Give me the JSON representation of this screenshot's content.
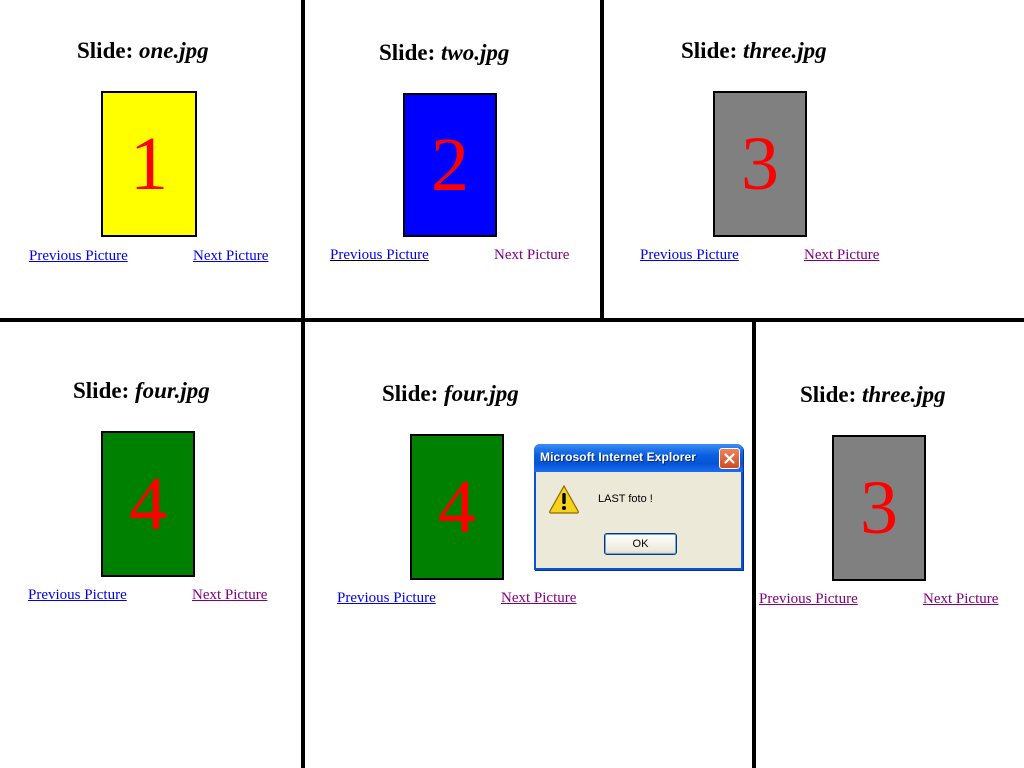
{
  "panels": [
    {
      "title_prefix": "Slide: ",
      "filename": "one.jpg",
      "slide_number": "1",
      "slide_color": "#ffff00",
      "prev_label": "Previous Picture",
      "next_label": "Next Picture"
    },
    {
      "title_prefix": "Slide: ",
      "filename": "two.jpg",
      "slide_number": "2",
      "slide_color": "#0000ff",
      "prev_label_first": "Previous",
      "prev_label_rest": " Picture",
      "next_label": "Next Picture"
    },
    {
      "title_prefix": "Slide: ",
      "filename": "three.jpg",
      "slide_number": "3",
      "slide_color": "#808080",
      "prev_label": "Previous Picture",
      "next_label": "Next Picture"
    },
    {
      "title_prefix": "Slide: ",
      "filename": "four.jpg",
      "slide_number": "4",
      "slide_color": "#008000",
      "prev_label": "Previous Picture",
      "next_label": "Next Picture"
    },
    {
      "title_prefix": "Slide: ",
      "filename": "four.jpg",
      "slide_number": "4",
      "slide_color": "#008000",
      "prev_label": "Previous Picture",
      "next_label": "Next Picture"
    },
    {
      "title_prefix": "Slide: ",
      "filename": "three.jpg",
      "slide_number": "3",
      "slide_color": "#808080",
      "prev_label": "Previous Picture",
      "next_label": "Next Picture"
    }
  ],
  "dialog": {
    "title": "Microsoft Internet Explorer",
    "message": "LAST foto !",
    "ok_label": "OK",
    "icon": "warning-icon",
    "close_icon": "close-icon"
  },
  "colors": {
    "link": "#0000ee",
    "visited_link": "#800080",
    "slide_digit": "#ff0000"
  }
}
